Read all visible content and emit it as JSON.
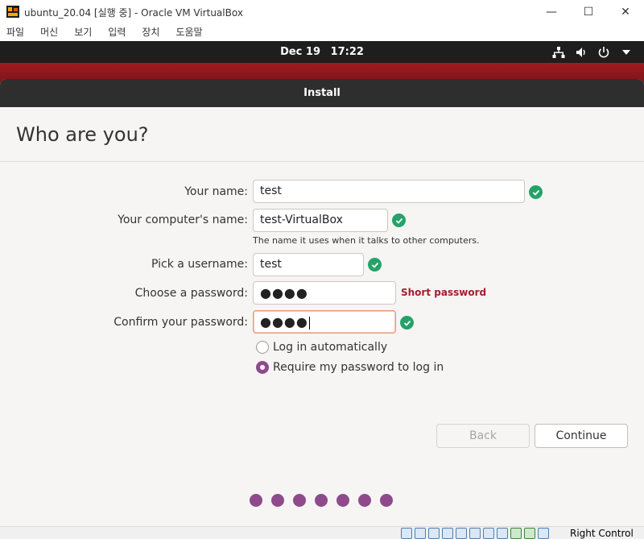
{
  "host_window": {
    "title": "ubuntu_20.04 [실행 중] - Oracle VM VirtualBox",
    "min_symbol": "—",
    "max_symbol": "☐",
    "close_symbol": "✕",
    "menu": [
      "파일",
      "머신",
      "보기",
      "입력",
      "장치",
      "도움말"
    ]
  },
  "panel": {
    "date": "Dec 19",
    "time": "17:22",
    "icons": [
      "network-icon",
      "volume-icon",
      "power-icon",
      "dropdown-arrow-icon"
    ]
  },
  "installer": {
    "header_title": "Install",
    "page_title": "Who are you?",
    "fields": {
      "name_label": "Your name:",
      "name_value": "test",
      "computer_label": "Your computer's name:",
      "computer_value": "test-VirtualBox",
      "computer_hint": "The name it uses when it talks to other computers.",
      "username_label": "Pick a username:",
      "username_value": "test",
      "password_label": "Choose a password:",
      "password_value": "●●●●",
      "password_warning": "Short password",
      "confirm_label": "Confirm your password:",
      "confirm_value": "●●●●"
    },
    "login_options": {
      "auto_label": "Log in automatically",
      "require_label": "Require my password to log in",
      "selected": "require"
    },
    "buttons": {
      "back_label": "Back",
      "continue_label": "Continue"
    },
    "progress": {
      "total_steps": 7
    }
  },
  "host_statusbar": {
    "host_key_label": "Right Control"
  },
  "colors": {
    "accent_purple": "#8f4a8c",
    "success_green": "#26a269",
    "warning_red": "#a51d2d",
    "panel_dark": "#1e1e1e",
    "desktop_red": "#a11a1f"
  }
}
